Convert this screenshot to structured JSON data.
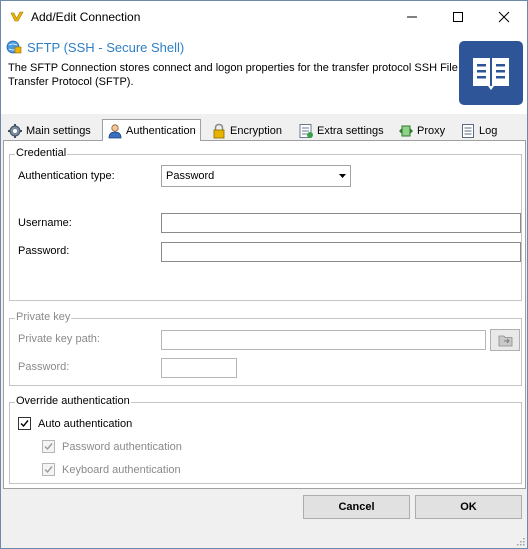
{
  "window": {
    "title": "Add/Edit Connection"
  },
  "header": {
    "title": "SFTP (SSH - Secure Shell)",
    "description": "The SFTP Connection stores connect and logon properties for the transfer protocol SSH File Transfer Protocol (SFTP)."
  },
  "tabs": [
    {
      "label": "Main settings",
      "icon": "gear-icon"
    },
    {
      "label": "Authentication",
      "icon": "user-icon"
    },
    {
      "label": "Encryption",
      "icon": "lock-icon"
    },
    {
      "label": "Extra settings",
      "icon": "settings-sheet-icon"
    },
    {
      "label": "Proxy",
      "icon": "proxy-icon"
    },
    {
      "label": "Log",
      "icon": "log-icon"
    }
  ],
  "active_tab": "Authentication",
  "credential": {
    "group_label": "Credential",
    "auth_type_label": "Authentication type:",
    "auth_type_value": "Password",
    "username_label": "Username:",
    "username_value": "",
    "password_label": "Password:",
    "password_value": ""
  },
  "private_key": {
    "group_label": "Private key",
    "path_label": "Private key path:",
    "path_value": "",
    "password_label": "Password:",
    "password_value": ""
  },
  "override": {
    "group_label": "Override authentication",
    "auto_label": "Auto authentication",
    "auto_checked": true,
    "password_auth_label": "Password authentication",
    "password_auth_checked": true,
    "keyboard_auth_label": "Keyboard authentication",
    "keyboard_auth_checked": true
  },
  "buttons": {
    "cancel": "Cancel",
    "ok": "OK"
  }
}
